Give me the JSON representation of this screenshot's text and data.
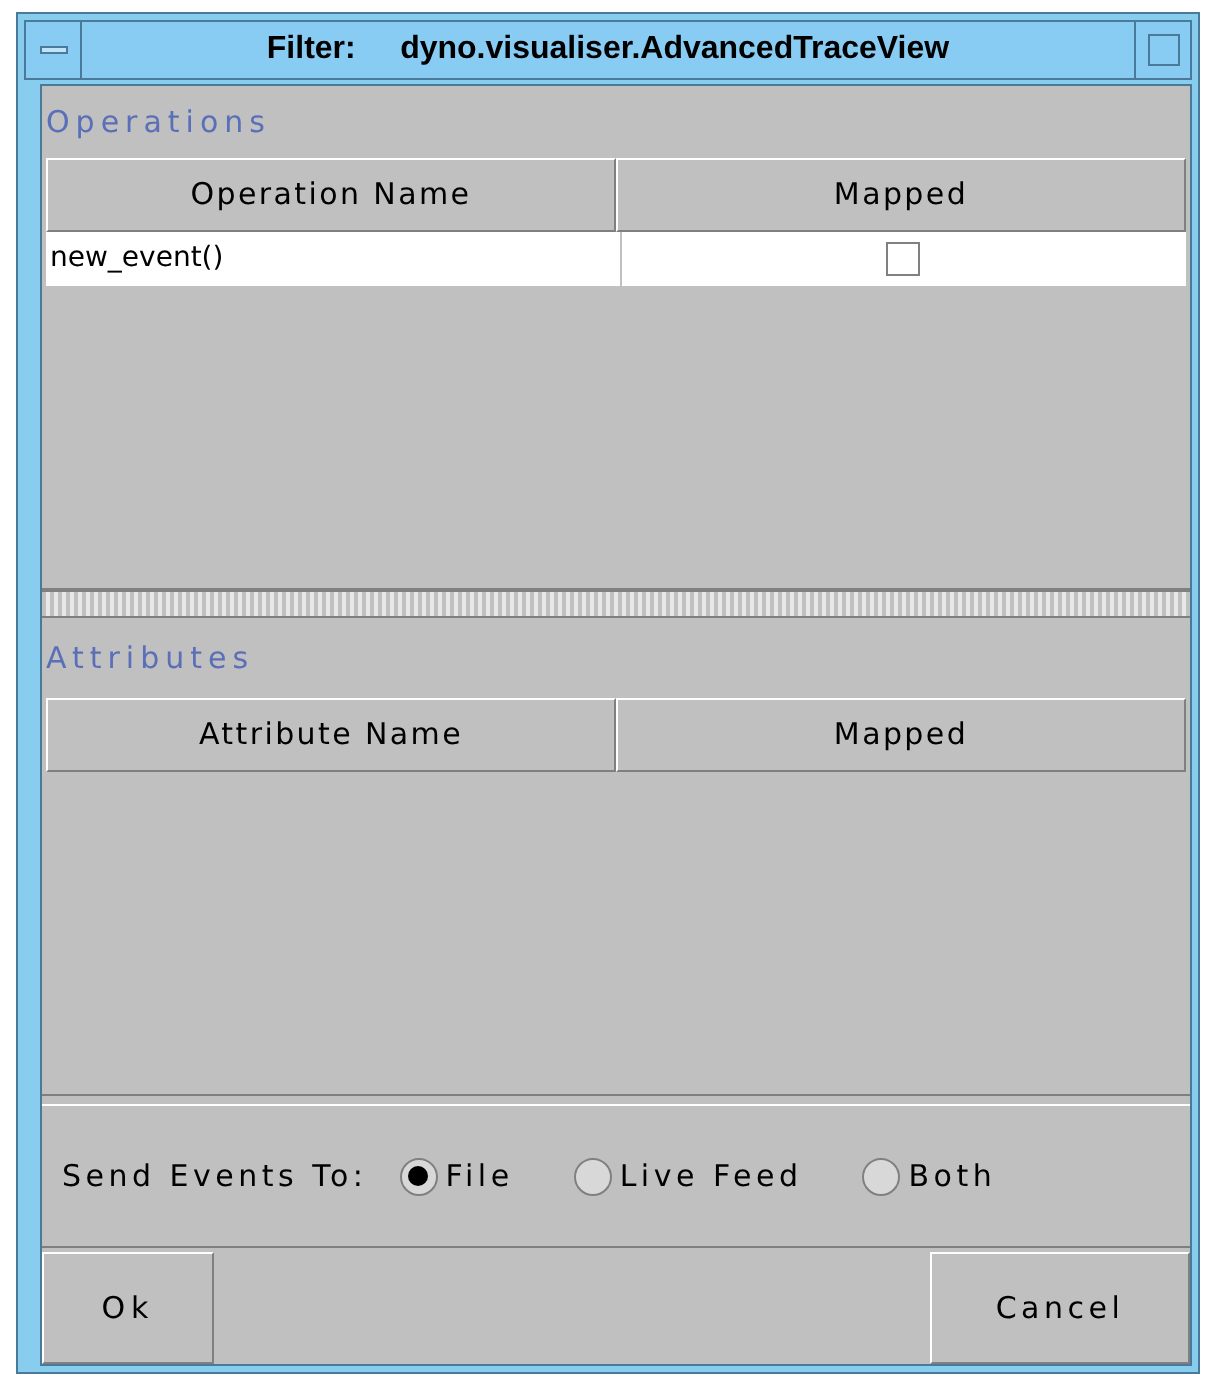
{
  "window": {
    "title": "Filter:     dyno.visualiser.AdvancedTraceView"
  },
  "operations": {
    "label": "Operations",
    "columns": [
      "Operation Name",
      "Mapped"
    ],
    "rows": [
      {
        "name": "new_event()",
        "mapped": false
      }
    ]
  },
  "attributes": {
    "label": "Attributes",
    "columns": [
      "Attribute Name",
      "Mapped"
    ]
  },
  "send_events": {
    "label": "Send Events To:",
    "options": [
      {
        "label": "File",
        "selected": true
      },
      {
        "label": "Live Feed",
        "selected": false
      },
      {
        "label": "Both",
        "selected": false
      }
    ]
  },
  "buttons": {
    "ok": "Ok",
    "cancel": "Cancel"
  }
}
